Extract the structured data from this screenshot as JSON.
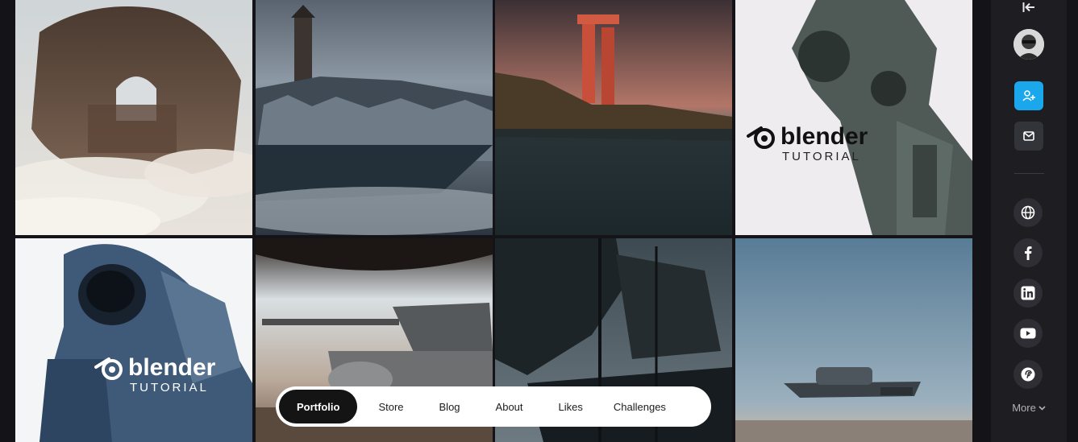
{
  "gallery": {
    "tiles": [
      {
        "id": "floating-castle",
        "caption": ""
      },
      {
        "id": "snow-village",
        "caption": ""
      },
      {
        "id": "red-monolith",
        "caption": ""
      },
      {
        "id": "robot-blender",
        "caption_word": "blender",
        "caption_sub": "TUTORIAL"
      },
      {
        "id": "astronaut-blender",
        "caption_word": "blender",
        "caption_sub": "TUTORIAL"
      },
      {
        "id": "tank",
        "caption": ""
      },
      {
        "id": "pirate-ship",
        "caption": ""
      },
      {
        "id": "hover-vehicle",
        "caption": ""
      }
    ]
  },
  "nav": {
    "items": [
      {
        "label": "Portfolio",
        "active": true
      },
      {
        "label": "Store",
        "active": false
      },
      {
        "label": "Blog",
        "active": false
      },
      {
        "label": "About",
        "active": false
      },
      {
        "label": "Likes",
        "active": false
      },
      {
        "label": "Challenges",
        "active": false
      }
    ]
  },
  "sidebar": {
    "more_label": "More",
    "icons": {
      "collapse": "collapse-left-icon",
      "follow": "add-user-icon",
      "message": "mail-icon",
      "website": "globe-icon",
      "facebook": "facebook-icon",
      "linkedin": "linkedin-icon",
      "youtube": "youtube-icon",
      "pinterest": "pinterest-icon"
    }
  },
  "colors": {
    "background": "#141418",
    "sidebar": "#1d1d22",
    "accent": "#1aa7ec",
    "social_bg": "#2e2e34"
  }
}
